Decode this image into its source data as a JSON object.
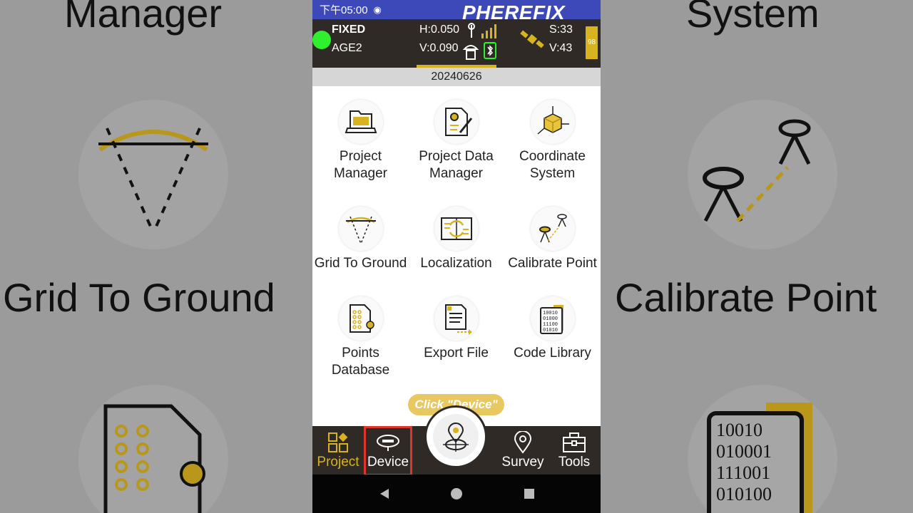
{
  "status_bar": {
    "time": "下午05:00",
    "brand": "PHEREFIX"
  },
  "gnss": {
    "fix": "FIXED",
    "age": "AGE2",
    "h_precision": "H:0.050",
    "v_precision": "V:0.090",
    "sats": "S:33",
    "visible": "V:43",
    "battery": "98"
  },
  "project_name": "20240626",
  "menu": [
    {
      "label": "Project Manager",
      "icon": "folder-laptop-icon"
    },
    {
      "label": "Project Data Manager",
      "icon": "document-gear-icon"
    },
    {
      "label": "Coordinate System",
      "icon": "cube-axes-icon"
    },
    {
      "label": "Grid To Ground",
      "icon": "grid-ground-icon"
    },
    {
      "label": "Localization",
      "icon": "localization-icon"
    },
    {
      "label": "Calibrate Point",
      "icon": "calibrate-point-icon"
    },
    {
      "label": "Points Database",
      "icon": "points-database-icon"
    },
    {
      "label": "Export File",
      "icon": "export-file-icon"
    },
    {
      "label": "Code Library",
      "icon": "code-library-icon"
    }
  ],
  "tooltip": "Click \"Device\"",
  "tabs": {
    "project": "Project",
    "device": "Device",
    "survey": "Survey",
    "tools": "Tools"
  },
  "background": {
    "left_top": "Manager",
    "left_mid": "Grid To Ground",
    "right_top": "System",
    "right_mid": "Calibrate Point"
  },
  "colors": {
    "accent": "#d6b31f",
    "bar": "#2f2a26",
    "status": "#3d49b8",
    "highlight": "#e0352b"
  }
}
